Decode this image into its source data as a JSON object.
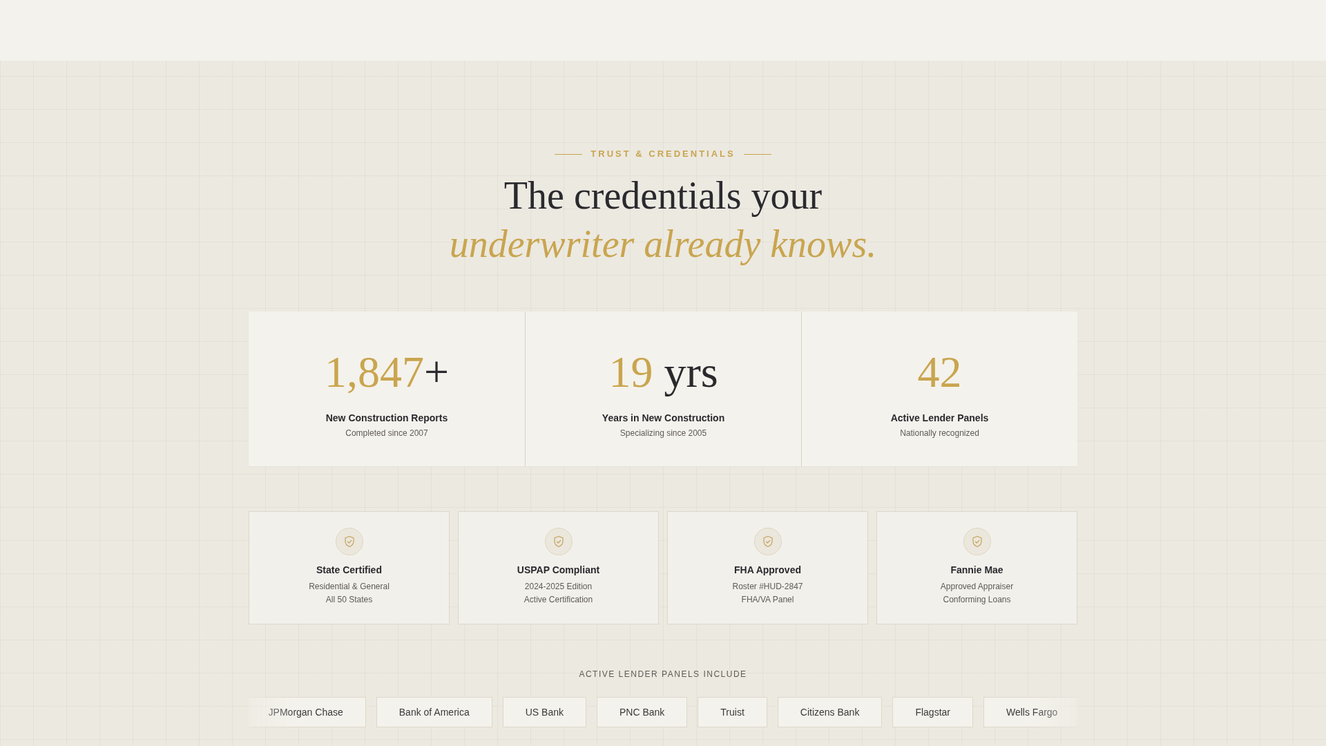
{
  "section": {
    "eyebrow": "TRUST & CREDENTIALS",
    "title": "The credentials your",
    "title_accent": "underwriter already knows."
  },
  "stats": [
    {
      "value": "1,847",
      "suffix": "+",
      "label": "New Construction Reports",
      "note": "Completed since 2007"
    },
    {
      "value": "19",
      "suffix": " yrs",
      "label": "Years in New Construction",
      "note": "Specializing since 2005"
    },
    {
      "value": "42",
      "label": "Active Lender Panels",
      "note": "Nationally recognized"
    }
  ],
  "credentials": [
    {
      "title": "State Certified",
      "lines": [
        "Residential & General",
        "All 50 States"
      ]
    },
    {
      "title": "USPAP Compliant",
      "lines": [
        "2024-2025 Edition",
        "Active Certification"
      ]
    },
    {
      "title": "FHA Approved",
      "lines": [
        "Roster #HUD-2847",
        "FHA/VA Panel"
      ]
    },
    {
      "title": "Fannie Mae",
      "lines": [
        "Approved Appraiser",
        "Conforming Loans"
      ]
    }
  ],
  "lenders": {
    "heading": "ACTIVE LENDER PANELS INCLUDE",
    "items": [
      "JPMorgan Chase",
      "Bank of America",
      "US Bank",
      "PNC Bank",
      "Truist",
      "Citizens Bank",
      "Flagstar",
      "Wells Fargo"
    ]
  }
}
